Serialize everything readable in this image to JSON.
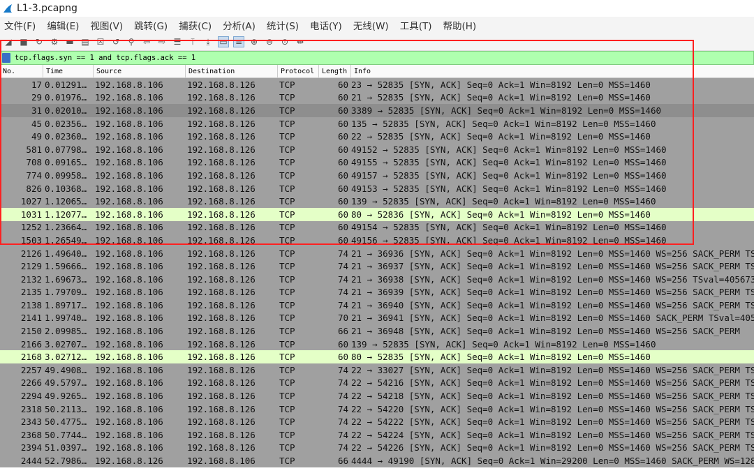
{
  "window": {
    "title": "L1-3.pcapng"
  },
  "menu": [
    "文件(F)",
    "编辑(E)",
    "视图(V)",
    "跳转(G)",
    "捕获(C)",
    "分析(A)",
    "统计(S)",
    "电话(Y)",
    "无线(W)",
    "工具(T)",
    "帮助(H)"
  ],
  "toolbar": [
    "start-capture-icon",
    "stop-capture-icon",
    "restart-capture-icon",
    "capture-options-icon",
    "open-file-icon",
    "save-file-icon",
    "close-file-icon",
    "reload-file-icon",
    "find-packet-icon",
    "go-back-icon",
    "go-forward-icon",
    "go-to-packet-icon",
    "go-first-icon",
    "go-last-icon",
    "autoscroll-icon",
    "colorize-icon",
    "zoom-in-icon",
    "zoom-out-icon",
    "zoom-normal-icon",
    "resize-columns-icon"
  ],
  "toolbar_symbols": [
    "◢",
    "■",
    "↻",
    "⚙",
    "▬",
    "▤",
    "☒",
    "↺",
    "⚲",
    "⇦",
    "⇨",
    "☰",
    "⤒",
    "⤓",
    "▭",
    "≡",
    "⊕",
    "⊖",
    "⊙",
    "⇹"
  ],
  "filter": {
    "text": "tcp.flags.syn == 1 and tcp.flags.ack == 1"
  },
  "columns": {
    "no": "No.",
    "time": "Time",
    "source": "Source",
    "destination": "Destination",
    "protocol": "Protocol",
    "length": "Length",
    "info": "Info"
  },
  "colors": {
    "filter_bg": "#afffaf",
    "row_bg": "#a0a0a0",
    "highlight_bg": "#e4ffc7",
    "box": "#ff2020"
  },
  "packets": [
    {
      "no": "17",
      "time": "0.01291…",
      "src": "192.168.8.106",
      "dst": "192.168.8.126",
      "proto": "TCP",
      "len": "60",
      "info": "23 → 52835 [SYN, ACK] Seq=0 Ack=1 Win=8192 Len=0 MSS=1460"
    },
    {
      "no": "29",
      "time": "0.01976…",
      "src": "192.168.8.106",
      "dst": "192.168.8.126",
      "proto": "TCP",
      "len": "60",
      "info": "21 → 52835 [SYN, ACK] Seq=0 Ack=1 Win=8192 Len=0 MSS=1460"
    },
    {
      "no": "31",
      "time": "0.02010…",
      "src": "192.168.8.106",
      "dst": "192.168.8.126",
      "proto": "TCP",
      "len": "60",
      "info": "3389 → 52835 [SYN, ACK] Seq=0 Ack=1 Win=8192 Len=0 MSS=1460",
      "style": "dark"
    },
    {
      "no": "45",
      "time": "0.02356…",
      "src": "192.168.8.106",
      "dst": "192.168.8.126",
      "proto": "TCP",
      "len": "60",
      "info": "135 → 52835 [SYN, ACK] Seq=0 Ack=1 Win=8192 Len=0 MSS=1460"
    },
    {
      "no": "49",
      "time": "0.02360…",
      "src": "192.168.8.106",
      "dst": "192.168.8.126",
      "proto": "TCP",
      "len": "60",
      "info": "22 → 52835 [SYN, ACK] Seq=0 Ack=1 Win=8192 Len=0 MSS=1460"
    },
    {
      "no": "581",
      "time": "0.07798…",
      "src": "192.168.8.106",
      "dst": "192.168.8.126",
      "proto": "TCP",
      "len": "60",
      "info": "49152 → 52835 [SYN, ACK] Seq=0 Ack=1 Win=8192 Len=0 MSS=1460"
    },
    {
      "no": "708",
      "time": "0.09165…",
      "src": "192.168.8.106",
      "dst": "192.168.8.126",
      "proto": "TCP",
      "len": "60",
      "info": "49155 → 52835 [SYN, ACK] Seq=0 Ack=1 Win=8192 Len=0 MSS=1460"
    },
    {
      "no": "774",
      "time": "0.09958…",
      "src": "192.168.8.106",
      "dst": "192.168.8.126",
      "proto": "TCP",
      "len": "60",
      "info": "49157 → 52835 [SYN, ACK] Seq=0 Ack=1 Win=8192 Len=0 MSS=1460"
    },
    {
      "no": "826",
      "time": "0.10368…",
      "src": "192.168.8.106",
      "dst": "192.168.8.126",
      "proto": "TCP",
      "len": "60",
      "info": "49153 → 52835 [SYN, ACK] Seq=0 Ack=1 Win=8192 Len=0 MSS=1460"
    },
    {
      "no": "1027",
      "time": "1.12065…",
      "src": "192.168.8.106",
      "dst": "192.168.8.126",
      "proto": "TCP",
      "len": "60",
      "info": "139 → 52835 [SYN, ACK] Seq=0 Ack=1 Win=8192 Len=0 MSS=1460"
    },
    {
      "no": "1031",
      "time": "1.12077…",
      "src": "192.168.8.106",
      "dst": "192.168.8.126",
      "proto": "TCP",
      "len": "60",
      "info": "80 → 52836 [SYN, ACK] Seq=0 Ack=1 Win=8192 Len=0 MSS=1460",
      "style": "hl"
    },
    {
      "no": "1252",
      "time": "1.23664…",
      "src": "192.168.8.106",
      "dst": "192.168.8.126",
      "proto": "TCP",
      "len": "60",
      "info": "49154 → 52835 [SYN, ACK] Seq=0 Ack=1 Win=8192 Len=0 MSS=1460"
    },
    {
      "no": "1503",
      "time": "1.26549…",
      "src": "192.168.8.106",
      "dst": "192.168.8.126",
      "proto": "TCP",
      "len": "60",
      "info": "49156 → 52835 [SYN, ACK] Seq=0 Ack=1 Win=8192 Len=0 MSS=1460"
    },
    {
      "no": "2126",
      "time": "1.49640…",
      "src": "192.168.8.106",
      "dst": "192.168.8.126",
      "proto": "TCP",
      "len": "74",
      "info": "21 → 36936 [SYN, ACK] Seq=0 Ack=1 Win=8192 Len=0 MSS=1460 WS=256 SACK_PERM TSv"
    },
    {
      "no": "2129",
      "time": "1.59666…",
      "src": "192.168.8.106",
      "dst": "192.168.8.126",
      "proto": "TCP",
      "len": "74",
      "info": "21 → 36937 [SYN, ACK] Seq=0 Ack=1 Win=8192 Len=0 MSS=1460 WS=256 SACK_PERM TSv"
    },
    {
      "no": "2132",
      "time": "1.69673…",
      "src": "192.168.8.106",
      "dst": "192.168.8.126",
      "proto": "TCP",
      "len": "74",
      "info": "21 → 36938 [SYN, ACK] Seq=0 Ack=1 Win=8192 Len=0 MSS=1460 WS=256 TSval=405673"
    },
    {
      "no": "2135",
      "time": "1.79709…",
      "src": "192.168.8.106",
      "dst": "192.168.8.126",
      "proto": "TCP",
      "len": "74",
      "info": "21 → 36939 [SYN, ACK] Seq=0 Ack=1 Win=8192 Len=0 MSS=1460 WS=256 SACK_PERM TSv"
    },
    {
      "no": "2138",
      "time": "1.89717…",
      "src": "192.168.8.106",
      "dst": "192.168.8.126",
      "proto": "TCP",
      "len": "74",
      "info": "21 → 36940 [SYN, ACK] Seq=0 Ack=1 Win=8192 Len=0 MSS=1460 WS=256 SACK_PERM TSv"
    },
    {
      "no": "2141",
      "time": "1.99740…",
      "src": "192.168.8.106",
      "dst": "192.168.8.126",
      "proto": "TCP",
      "len": "70",
      "info": "21 → 36941 [SYN, ACK] Seq=0 Ack=1 Win=8192 Len=0 MSS=1460 SACK_PERM TSval=4057"
    },
    {
      "no": "2150",
      "time": "2.09985…",
      "src": "192.168.8.106",
      "dst": "192.168.8.126",
      "proto": "TCP",
      "len": "66",
      "info": "21 → 36948 [SYN, ACK] Seq=0 Ack=1 Win=8192 Len=0 MSS=1460 WS=256 SACK_PERM"
    },
    {
      "no": "2166",
      "time": "3.02707…",
      "src": "192.168.8.106",
      "dst": "192.168.8.126",
      "proto": "TCP",
      "len": "60",
      "info": "139 → 52835 [SYN, ACK] Seq=0 Ack=1 Win=8192 Len=0 MSS=1460"
    },
    {
      "no": "2168",
      "time": "3.02712…",
      "src": "192.168.8.106",
      "dst": "192.168.8.126",
      "proto": "TCP",
      "len": "60",
      "info": "80 → 52835 [SYN, ACK] Seq=0 Ack=1 Win=8192 Len=0 MSS=1460",
      "style": "hl"
    },
    {
      "no": "2257",
      "time": "49.4908…",
      "src": "192.168.8.106",
      "dst": "192.168.8.126",
      "proto": "TCP",
      "len": "74",
      "info": "22 → 33027 [SYN, ACK] Seq=0 Ack=1 Win=8192 Len=0 MSS=1460 WS=256 SACK_PERM TSv"
    },
    {
      "no": "2266",
      "time": "49.5797…",
      "src": "192.168.8.106",
      "dst": "192.168.8.126",
      "proto": "TCP",
      "len": "74",
      "info": "22 → 54216 [SYN, ACK] Seq=0 Ack=1 Win=8192 Len=0 MSS=1460 WS=256 SACK_PERM TSv"
    },
    {
      "no": "2294",
      "time": "49.9265…",
      "src": "192.168.8.106",
      "dst": "192.168.8.126",
      "proto": "TCP",
      "len": "74",
      "info": "22 → 54218 [SYN, ACK] Seq=0 Ack=1 Win=8192 Len=0 MSS=1460 WS=256 SACK_PERM TSv"
    },
    {
      "no": "2318",
      "time": "50.2113…",
      "src": "192.168.8.106",
      "dst": "192.168.8.126",
      "proto": "TCP",
      "len": "74",
      "info": "22 → 54220 [SYN, ACK] Seq=0 Ack=1 Win=8192 Len=0 MSS=1460 WS=256 SACK_PERM TSv"
    },
    {
      "no": "2343",
      "time": "50.4775…",
      "src": "192.168.8.106",
      "dst": "192.168.8.126",
      "proto": "TCP",
      "len": "74",
      "info": "22 → 54222 [SYN, ACK] Seq=0 Ack=1 Win=8192 Len=0 MSS=1460 WS=256 SACK_PERM TSv"
    },
    {
      "no": "2368",
      "time": "50.7744…",
      "src": "192.168.8.106",
      "dst": "192.168.8.126",
      "proto": "TCP",
      "len": "74",
      "info": "22 → 54224 [SYN, ACK] Seq=0 Ack=1 Win=8192 Len=0 MSS=1460 WS=256 SACK_PERM TSv"
    },
    {
      "no": "2394",
      "time": "51.0397…",
      "src": "192.168.8.106",
      "dst": "192.168.8.126",
      "proto": "TCP",
      "len": "74",
      "info": "22 → 54226 [SYN, ACK] Seq=0 Ack=1 Win=8192 Len=0 MSS=1460 WS=256 SACK_PERM TSv"
    },
    {
      "no": "2444",
      "time": "52.7986…",
      "src": "192.168.8.126",
      "dst": "192.168.8.106",
      "proto": "TCP",
      "len": "66",
      "info": "4444 → 49190 [SYN, ACK] Seq=0 Ack=1 Win=29200 Len=0 MSS=1460 SACK_PERM WS=128"
    }
  ]
}
